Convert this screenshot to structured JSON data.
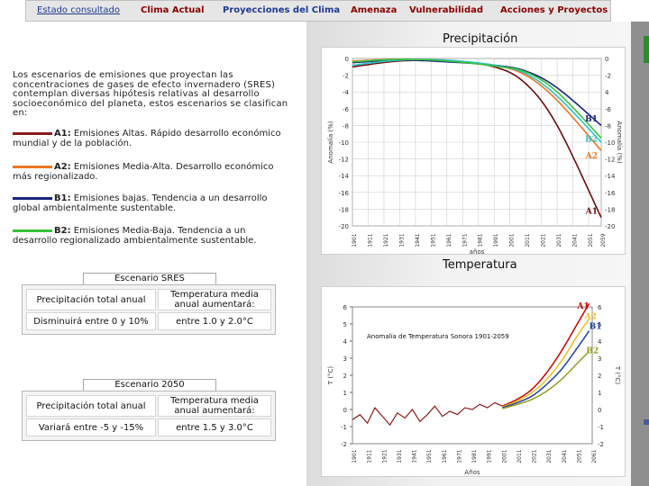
{
  "nav": {
    "items": [
      {
        "label": "Estado consultado"
      },
      {
        "label": "Clima Actual"
      },
      {
        "label": "Proyecciones del Clima"
      },
      {
        "label": "Amenaza"
      },
      {
        "label": "Vulnerabilidad"
      },
      {
        "label": "Acciones y Proyectos"
      }
    ]
  },
  "intro_text": "Los escenarios de emisiones que proyectan las concentraciones de gases de efecto invernadero (SRES) contemplan diversas hipótesis relativas al desarrollo socioeconómico del planeta, estos escenarios se clasifican en:",
  "scenarios": [
    {
      "code": "A1:",
      "text": "Emisiones Altas. Rápido desarrollo económico mundial y de la población.",
      "color": "#8b1a1a"
    },
    {
      "code": "A2:",
      "text": "Emisiones Media-Alta. Desarrollo económico más regionalizado.",
      "color": "#e87722"
    },
    {
      "code": "B1:",
      "text": "Emisiones bajas. Tendencia a un desarrollo global ambientalmente sustentable.",
      "color": "#1a237e"
    },
    {
      "code": "B2:",
      "text": "Emisiones Media-Baja. Tendencia a un desarrollo regionalizado ambientalmente sustentable.",
      "color": "#39c23b"
    }
  ],
  "tables": [
    {
      "scenario": "Escenario SRES",
      "col1_header": "Precipitación total anual",
      "col2_header": "Temperatura media anual aumentará:",
      "col1_value": "Disminuirá entre 0 y 10%",
      "col2_value": "entre 1.0 y 2.0°C"
    },
    {
      "scenario": "Escenario 2050",
      "col1_header": "Precipitación total anual",
      "col2_header": "Temperatura media anual aumentará:",
      "col1_value": "Variará entre -5 y -15%",
      "col2_value": "entre 1.5 y 3.0°C"
    }
  ],
  "precip": {
    "title": "Precipitación",
    "ylabel_left": "Anomalía (%)",
    "ylabel_right": "Anomalía (%)",
    "xlabel": "años"
  },
  "temp": {
    "title": "Temperatura",
    "inner_title": "Anomalía de Temperatura Sonora 1901-2059",
    "ylabel_left": "T (°C)",
    "ylabel_right": "T (°C)",
    "xlabel": "Años"
  },
  "chart_data": [
    {
      "type": "line",
      "title": "Precipitación",
      "xlabel": "años",
      "ylabel": "Anomalía (%)",
      "ylim": [
        -20,
        0
      ],
      "xlim": [
        1901,
        2059
      ],
      "yticks": [
        0,
        -2,
        -4,
        -6,
        -8,
        -10,
        -12,
        -14,
        -16,
        -18,
        -20
      ],
      "yticks_right": [
        0,
        -2,
        4,
        -6,
        -8,
        -10,
        -12,
        -14,
        -16,
        -18,
        -20
      ],
      "xticks": [
        "1901",
        "1911",
        "1921",
        "1931",
        "1941",
        "1951",
        "1961",
        "1971",
        "1981",
        "1991",
        "2001",
        "2011",
        "2021",
        "2031",
        "2041",
        "2051",
        "2059"
      ],
      "grid": true,
      "x": [
        1901,
        1931,
        1961,
        1991,
        2011,
        2031,
        2059
      ],
      "series": [
        {
          "name": "A1",
          "color": "#6b0f0f",
          "values": [
            -1.0,
            -0.3,
            -0.3,
            -1.0,
            -3.0,
            -8.0,
            -19.0
          ]
        },
        {
          "name": "A2",
          "color": "#e87722",
          "values": [
            -0.3,
            -0.1,
            -0.3,
            -0.8,
            -2.0,
            -5.0,
            -11.0
          ]
        },
        {
          "name": "B1",
          "color": "#1a237e",
          "values": [
            -0.5,
            -0.2,
            -0.4,
            -0.8,
            -1.5,
            -3.5,
            -8.0
          ]
        },
        {
          "name": "B2",
          "color": "#2ec4c4",
          "values": [
            -0.8,
            -0.2,
            -0.2,
            -0.8,
            -1.8,
            -4.5,
            -10.0
          ]
        },
        {
          "name": "",
          "color": "#39c23b",
          "values": [
            -0.4,
            -0.1,
            -0.3,
            -0.9,
            -1.6,
            -4.0,
            -9.5
          ]
        }
      ],
      "labels": [
        "B1",
        "B2",
        "A1",
        "A2"
      ]
    },
    {
      "type": "line",
      "title": "Anomalía de Temperatura Sonora 1901-2059",
      "xlabel": "Años",
      "ylabel": "T (°C)",
      "ylim": [
        -2,
        6
      ],
      "xlim": [
        1901,
        2059
      ],
      "yticks": [
        6,
        5,
        4,
        3,
        2,
        1,
        0,
        -1,
        -2
      ],
      "xticks": [
        "1901",
        "1911",
        "1921",
        "1931",
        "1941",
        "1951",
        "1961",
        "1971",
        "1981",
        "1991",
        "2001",
        "2011",
        "2021",
        "2031",
        "2041",
        "2051",
        "2061"
      ],
      "grid": false,
      "x": [
        2001,
        2011,
        2021,
        2031,
        2041,
        2051,
        2059
      ],
      "series": [
        {
          "name": "A1",
          "color": "#cc0000",
          "values": [
            0.2,
            0.6,
            1.2,
            2.2,
            3.5,
            5.0,
            6.2
          ]
        },
        {
          "name": "A2",
          "color": "#e8c020",
          "values": [
            0.15,
            0.5,
            1.0,
            1.8,
            2.9,
            4.3,
            5.3
          ]
        },
        {
          "name": "B1",
          "color": "#2040a0",
          "values": [
            0.1,
            0.4,
            0.8,
            1.5,
            2.4,
            3.6,
            4.6
          ]
        },
        {
          "name": "B2",
          "color": "#90a020",
          "values": [
            0.05,
            0.3,
            0.6,
            1.1,
            1.8,
            2.7,
            3.4
          ]
        }
      ],
      "observed": {
        "name": "",
        "color": "#8b1a1a",
        "x": [
          1901,
          1906,
          1911,
          1916,
          1921,
          1926,
          1931,
          1936,
          1941,
          1946,
          1951,
          1956,
          1961,
          1966,
          1971,
          1976,
          1981,
          1986,
          1991,
          1996,
          2001
        ],
        "values": [
          -0.6,
          -0.3,
          -0.8,
          0.1,
          -0.4,
          -0.9,
          -0.2,
          -0.5,
          0.0,
          -0.7,
          -0.3,
          0.2,
          -0.4,
          -0.1,
          -0.3,
          0.1,
          0.0,
          0.3,
          0.1,
          0.4,
          0.2
        ]
      },
      "labels": [
        "A1",
        "A2",
        "B1",
        "B2"
      ]
    }
  ]
}
